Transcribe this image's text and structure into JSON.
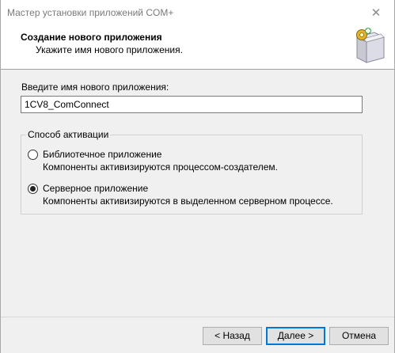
{
  "window": {
    "title": "Мастер установки приложений COM+",
    "close_glyph": "✕"
  },
  "header": {
    "title": "Создание нового приложения",
    "subtitle": "Укажите имя нового приложения.",
    "icon": "wizard-box-icon"
  },
  "name_field": {
    "label": "Введите имя нового приложения:",
    "value": "1CV8_ComConnect"
  },
  "activation": {
    "legend": "Способ активации",
    "options": [
      {
        "label": "Библиотечное приложение",
        "description": "Компоненты активизируются процессом-создателем.",
        "checked": false
      },
      {
        "label": "Серверное приложение",
        "description": "Компоненты активизируются в выделенном серверном процессе.",
        "checked": true
      }
    ]
  },
  "buttons": {
    "back": "< Назад",
    "next": "Далее >",
    "cancel": "Отмена"
  }
}
